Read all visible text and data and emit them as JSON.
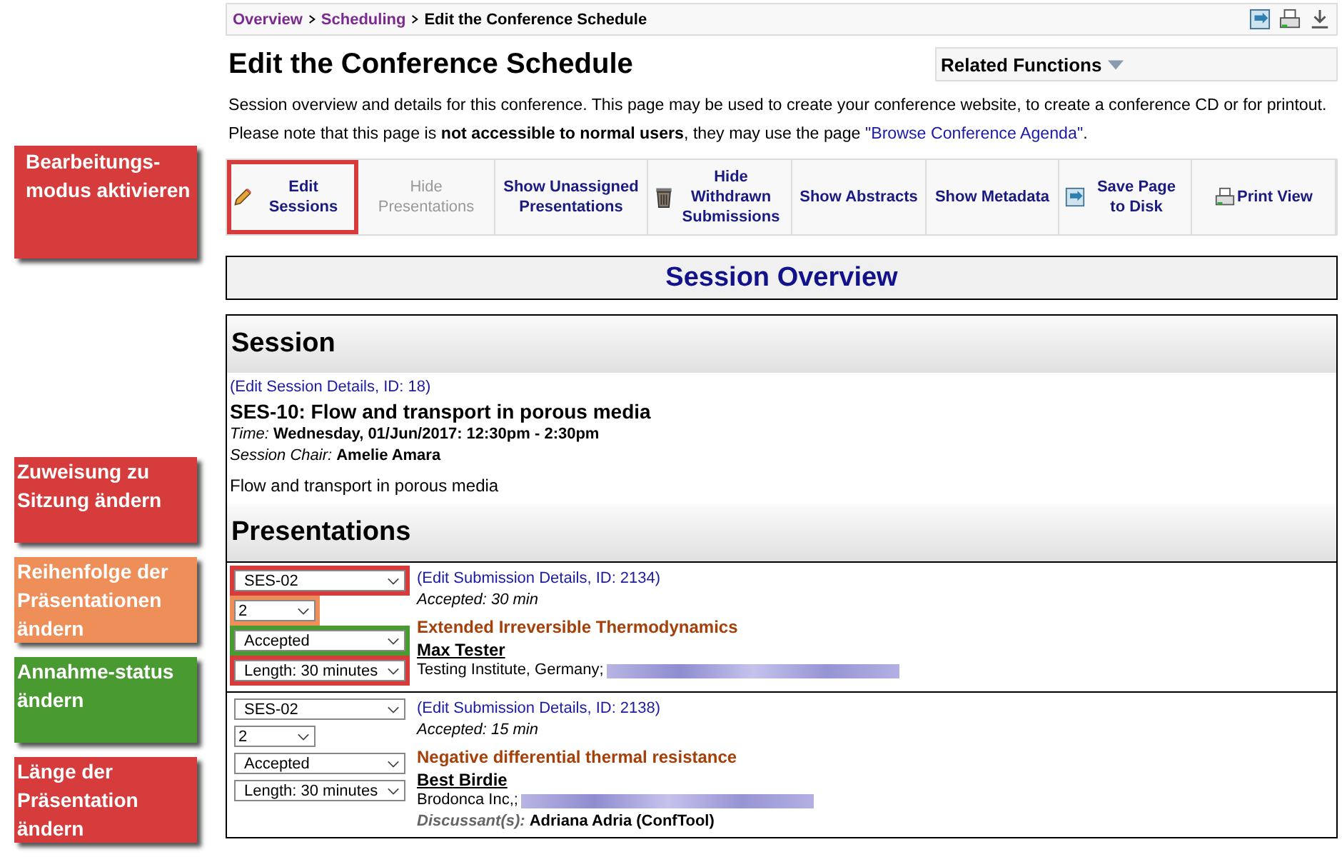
{
  "callouts": [
    {
      "text": "Bearbeitungs-modus aktivieren",
      "color": "#d63c3c"
    },
    {
      "text": "Zuweisung zu Sitzung ändern",
      "color": "#d63c3c"
    },
    {
      "text": "Reihenfolge der Präsentationen ändern",
      "color": "#ee8f5a"
    },
    {
      "text": "Annahme-status ändern",
      "color": "#4a9a32"
    },
    {
      "text": "Länge der Präsentation ändern",
      "color": "#d63c3c"
    }
  ],
  "breadcrumb": [
    {
      "label": "Overview",
      "link": true
    },
    {
      "label": "Scheduling",
      "link": true
    },
    {
      "label": "Edit the Conference Schedule",
      "link": false
    }
  ],
  "page_title": "Edit the Conference Schedule",
  "related_functions": "Related Functions",
  "description": "Session overview and details for this conference. This page may be used to create your conference website, to create a conference CD or for printout.",
  "note": {
    "before": "Please note that this page is **not accessible to normal users**, they may use the page ",
    "link": "\"Browse Conference Agenda\"",
    "after": "."
  },
  "toolbar": [
    {
      "label": "Edit Sessions",
      "kind": "pencil",
      "disabled": false,
      "color": "#d63c3c"
    },
    {
      "label": "Hide Presentations",
      "kind": "plain",
      "disabled": true
    },
    {
      "label": "Show Unassigned Presentations",
      "kind": "plain",
      "disabled": false
    },
    {
      "label": "Hide Withdrawn Submissions",
      "kind": "trash",
      "disabled": false
    },
    {
      "label": "Show Abstracts",
      "kind": "plain",
      "disabled": false
    },
    {
      "label": "Show Metadata",
      "kind": "plain",
      "disabled": false
    },
    {
      "label": "Save Page to Disk",
      "kind": "save",
      "disabled": false
    },
    {
      "label": "Print View",
      "kind": "printer",
      "disabled": false
    }
  ],
  "overview_title": "Session Overview",
  "session": {
    "heading": "Session",
    "edit_link": "(Edit Session Details, ID: 18)",
    "title": "SES-10: Flow and transport in porous media",
    "time_label": "Time:",
    "time": "Wednesday, 01/Jun/2017: 12:30pm - 2:30pm",
    "chair_label": "Session Chair:",
    "chair": "Amelie Amara",
    "description": "Flow and transport in porous media"
  },
  "presentations_heading": "Presentations",
  "presentations": [
    {
      "controls": [
        {
          "kind": "session",
          "value": "SES-02",
          "color": "#d63c3c"
        },
        {
          "kind": "order",
          "value": "2",
          "color": "#ee8f5a"
        },
        {
          "kind": "status",
          "value": "Accepted",
          "color": "#4a9a32"
        },
        {
          "kind": "length",
          "value": "Length: 30 minutes",
          "color": "#d63c3c"
        }
      ],
      "edit_link": "(Edit Submission Details, ID: 2134)",
      "accepted": "Accepted: 30 min",
      "title": "Extended Irreversible Thermodynamics",
      "author": "Max Tester",
      "affiliation": "Testing Institute, Germany;"
    },
    {
      "controls": [
        {
          "kind": "session",
          "value": "SES-02"
        },
        {
          "kind": "order",
          "value": "2"
        },
        {
          "kind": "status",
          "value": "Accepted"
        },
        {
          "kind": "length",
          "value": "Length: 30 minutes"
        }
      ],
      "edit_link": "(Edit Submission Details, ID: 2138)",
      "accepted": "Accepted: 15 min",
      "title": "Negative differential thermal resistance",
      "author": "Best Birdie",
      "affiliation": "Brodonca Inc,;",
      "discussant_label": "Discussant(s):",
      "discussant": "Adriana Adria (ConfTool)"
    }
  ]
}
